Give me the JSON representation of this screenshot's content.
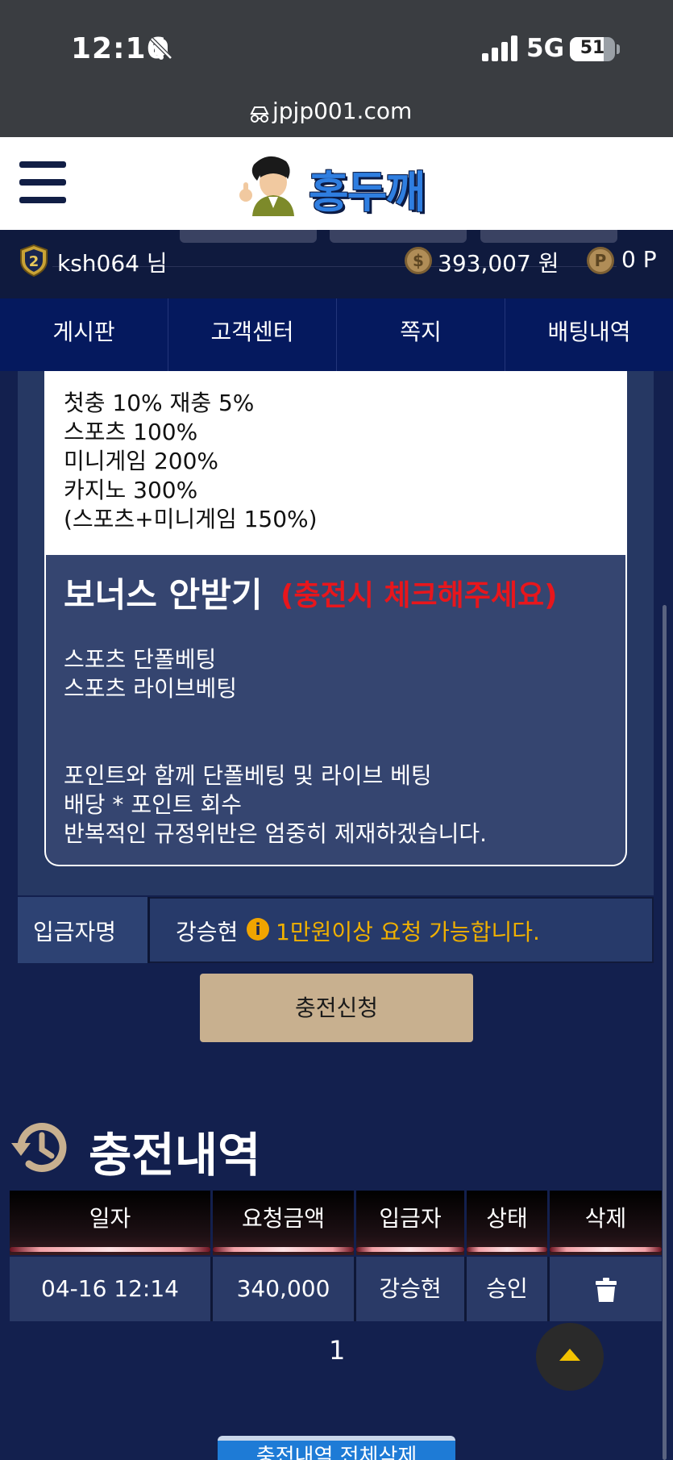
{
  "status_bar": {
    "time": "12:16",
    "network": "5G",
    "battery": "51"
  },
  "browser": {
    "url": "jpjp001.com"
  },
  "header": {
    "logo_text": "홍두깨"
  },
  "user": {
    "level": "2",
    "name": "ksh064 님",
    "money": "393,007 원",
    "money_icon": "$",
    "points": "0 P",
    "points_icon": "P"
  },
  "nav": {
    "items": [
      "게시판",
      "고객센터",
      "쪽지",
      "배팅내역"
    ]
  },
  "bonus": {
    "lines": [
      "첫충 10% 재충 5%",
      "스포츠 100%",
      "미니게임 200%",
      "카지노 300%",
      "(스포츠+미니게임 150%)"
    ]
  },
  "no_bonus": {
    "title": "보너스 안받기",
    "title_note": "(충전시 체크해주세요)",
    "lines": [
      "스포츠 단폴베팅",
      "스포츠 라이브베팅",
      "",
      "",
      "포인트와 함께 단폴베팅 및 라이브 베팅",
      "배당 * 포인트 회수",
      "반복적인 규정위반은 엄중히 제재하겠습니다."
    ]
  },
  "depositor": {
    "label": "입금자명",
    "name": "강승현",
    "info_icon": "i",
    "info": "1만원이상 요청 가능합니다."
  },
  "charge_button": "충전신청",
  "history": {
    "title": "충전내역",
    "columns": [
      "일자",
      "요청금액",
      "입금자",
      "상태",
      "삭제"
    ],
    "rows": [
      {
        "date": "04-16 12:14",
        "amount": "340,000",
        "depositor": "강승현",
        "status": "승인"
      }
    ]
  },
  "pager": {
    "current": "1"
  },
  "delete_all_button": "충전내역 전체삭제"
}
